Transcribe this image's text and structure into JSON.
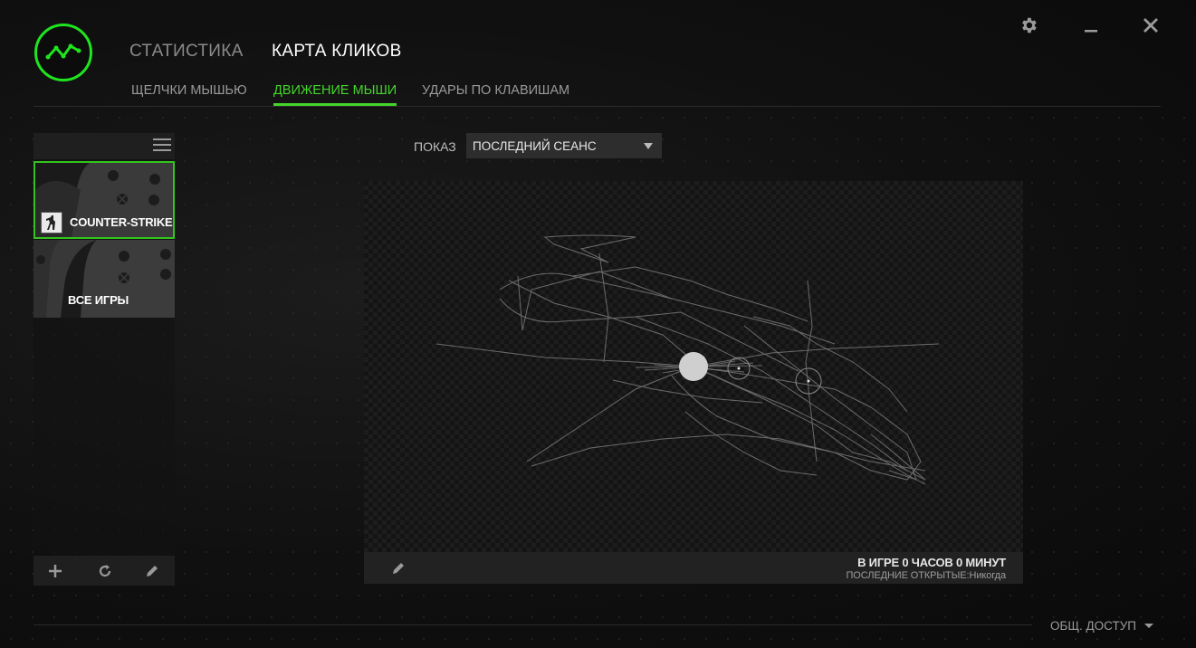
{
  "header": {
    "logo_icon": "razer-cortex-gamer-stats-icon",
    "tabs": [
      {
        "label": "СТАТИСТИКА",
        "active": false
      },
      {
        "label": "КАРТА КЛИКОВ",
        "active": true
      }
    ],
    "subtabs": [
      {
        "label": "ЩЕЛЧКИ МЫШЬЮ",
        "active": false
      },
      {
        "label": "ДВИЖЕНИЕ МЫШИ",
        "active": true
      },
      {
        "label": "УДАРЫ ПО КЛАВИШАМ",
        "active": false
      }
    ],
    "window_controls": [
      "gear-icon",
      "minimize-icon",
      "close-icon"
    ]
  },
  "sidebar": {
    "games": [
      {
        "label": "COUNTER-STRIKE",
        "selected": true
      },
      {
        "label": "ВСЕ ИГРЫ",
        "selected": false
      }
    ],
    "buttons": [
      "plus-icon",
      "refresh-icon",
      "pencil-icon"
    ]
  },
  "main": {
    "show_label": "ПОКАЗ",
    "show_value": "ПОСЛЕДНИЙ СЕАНС",
    "time_in_game": "В ИГРЕ 0 ЧАСОВ 0 МИНУТ",
    "last_opened": "ПОСЛЕДНИЕ ОТКРЫТЫЕ:Никогда"
  },
  "footer": {
    "share_label": "ОБЩ. ДОСТУП"
  },
  "colors": {
    "accent": "#44d62c",
    "background": "#0f0f0f",
    "panel": "#1f1f1f"
  }
}
